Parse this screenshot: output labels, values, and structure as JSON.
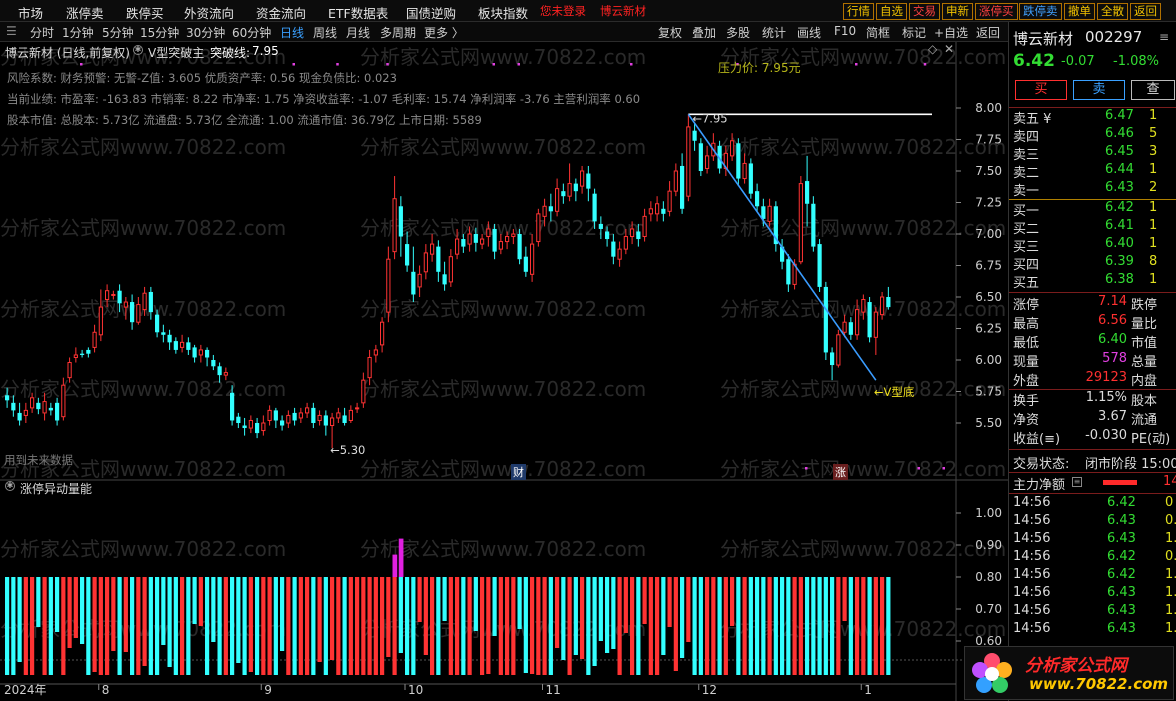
{
  "menu": {
    "items": [
      "市场",
      "涨停卖",
      "跌停买",
      "外资流向",
      "资金流向",
      "ETF数据表",
      "国债逆购",
      "板块指数"
    ],
    "login_text": "您未登录",
    "stock_tag": "博云新材",
    "tools": [
      "行情",
      "自选",
      "交易",
      "申新",
      "涨停买",
      "跌停卖",
      "撤单",
      "全散",
      "返回"
    ]
  },
  "periods": {
    "items": [
      "分时",
      "1分钟",
      "5分钟",
      "15分钟",
      "30分钟",
      "60分钟",
      "日线",
      "周线",
      "月线",
      "多周期",
      "更多 〉"
    ],
    "active": "日线",
    "right": [
      "复权",
      "叠加",
      "多股",
      "统计",
      "画线",
      "F10",
      "简框",
      "标记",
      "+自选",
      "返回"
    ]
  },
  "chart": {
    "title": "博云新材 (日线,前复权)",
    "indicator": "V型突破主",
    "break_label": "突破线:",
    "break_value": "7.95",
    "info": [
      "风险系数: 财务预警: 无警-Z值: 3.605 优质资产率: 0.56 现金负债比: 0.023",
      "当前业绩: 市盈率: -163.83 市销率: 8.22 市净率: 1.75 净资收益率: -1.07 毛利率: 15.74 净利润率 -3.76 主营利润率 0.60",
      "股本市值: 总股本: 5.73亿 流通盘: 5.73亿 全流通: 1.00 流通市值: 36.79亿 上市日期: 5589"
    ],
    "top_note": "压力价: 7.95元",
    "future_note": "用到未来数据",
    "hi_label": "7.95",
    "lo_label": "5.30",
    "v_label": "V型底",
    "mark_cai": "财",
    "mark_zhang": "涨",
    "yticks": [
      "8.00",
      "7.75",
      "7.50",
      "7.25",
      "7.00",
      "6.75",
      "6.50",
      "6.25",
      "6.00",
      "5.75",
      "5.50"
    ]
  },
  "sub": {
    "title": "涨停异动量能",
    "yticks": [
      "1.00",
      "0.90",
      "0.80",
      "0.70",
      "0.60"
    ]
  },
  "xaxis": {
    "labels": [
      "2024年",
      "8",
      "9",
      "10",
      "11",
      "12",
      "1"
    ]
  },
  "watermark": "分析家公式网www.70822.com",
  "logo": {
    "line1": "分析家公式网",
    "line2": "www.70822.com"
  },
  "quote": {
    "name": "博云新材",
    "code": "002297",
    "price": "6.42",
    "change": "-0.07",
    "pct": "-1.08%",
    "buy": "买",
    "sell": "卖",
    "query": "查",
    "asks": [
      {
        "label": "卖五 ¥",
        "price": "6.47",
        "vol": "1"
      },
      {
        "label": "卖四",
        "price": "6.46",
        "vol": "5"
      },
      {
        "label": "卖三",
        "price": "6.45",
        "vol": "3"
      },
      {
        "label": "卖二",
        "price": "6.44",
        "vol": "1"
      },
      {
        "label": "卖一",
        "price": "6.43",
        "vol": "2"
      }
    ],
    "bids": [
      {
        "label": "买一",
        "price": "6.42",
        "vol": "1"
      },
      {
        "label": "买二",
        "price": "6.41",
        "vol": "1"
      },
      {
        "label": "买三",
        "price": "6.40",
        "vol": "1"
      },
      {
        "label": "买四",
        "price": "6.39",
        "vol": "8"
      },
      {
        "label": "买五",
        "price": "6.38",
        "vol": "1"
      }
    ],
    "stats": [
      {
        "l1": "涨停",
        "v1": "7.14",
        "c1": "#ff3030",
        "l2": "跌停"
      },
      {
        "l1": "最高",
        "v1": "6.56",
        "c1": "#ff3030",
        "l2": "量比"
      },
      {
        "l1": "最低",
        "v1": "6.40",
        "c1": "#33dd33",
        "l2": "市值"
      },
      {
        "l1": "现量",
        "v1": "578",
        "c1": "#e040e0",
        "l2": "总量"
      },
      {
        "l1": "外盘",
        "v1": "29123",
        "c1": "#ff3030",
        "l2": "内盘"
      },
      {
        "l1": "换手",
        "v1": "1.15%",
        "c1": "#dcdcdc",
        "l2": "股本"
      },
      {
        "l1": "净资",
        "v1": "3.67",
        "c1": "#dcdcdc",
        "l2": "流通"
      },
      {
        "l1": "收益(≡)",
        "v1": "-0.030",
        "c1": "#dcdcdc",
        "l2": "PE(动)"
      }
    ],
    "status_label": "交易状态:",
    "status_value": "闭市阶段 15:00",
    "flow_label": "主力净额",
    "flow_value": "14",
    "ticks": [
      {
        "t": "14:56",
        "p": "6.42",
        "v": "0"
      },
      {
        "t": "14:56",
        "p": "6.43",
        "v": "0."
      },
      {
        "t": "14:56",
        "p": "6.43",
        "v": "1."
      },
      {
        "t": "14:56",
        "p": "6.42",
        "v": "0."
      },
      {
        "t": "14:56",
        "p": "6.42",
        "v": "1."
      },
      {
        "t": "14:56",
        "p": "6.43",
        "v": "1."
      },
      {
        "t": "14:56",
        "p": "6.43",
        "v": "1."
      },
      {
        "t": "14:56",
        "p": "6.43",
        "v": "1."
      }
    ]
  },
  "chart_data": {
    "type": "candlestick",
    "ylim": [
      5.3,
      8.1
    ],
    "annotations": {
      "high": 7.95,
      "low": 5.3,
      "v_bottom_low": 5.84,
      "breakout_line": 7.95
    },
    "candles": [
      [
        5.72,
        5.68,
        5.78,
        5.62
      ],
      [
        5.66,
        5.6,
        5.72,
        5.55
      ],
      [
        5.58,
        5.52,
        5.66,
        5.48
      ],
      [
        5.56,
        5.6,
        5.66,
        5.5
      ],
      [
        5.62,
        5.7,
        5.74,
        5.58
      ],
      [
        5.66,
        5.61,
        5.7,
        5.57
      ],
      [
        5.58,
        5.67,
        5.74,
        5.52
      ],
      [
        5.62,
        5.6,
        5.66,
        5.56
      ],
      [
        5.66,
        5.52,
        5.7,
        5.48
      ],
      [
        5.55,
        5.8,
        5.86,
        5.52
      ],
      [
        5.86,
        5.98,
        6.02,
        5.82
      ],
      [
        6.02,
        6.04,
        6.1,
        5.98
      ],
      [
        6.05,
        6.04,
        6.08,
        6.02
      ],
      [
        6.08,
        6.05,
        6.1,
        6.02
      ],
      [
        6.1,
        6.22,
        6.28,
        6.06
      ],
      [
        6.2,
        6.42,
        6.56,
        6.15
      ],
      [
        6.48,
        6.55,
        6.6,
        6.42
      ],
      [
        6.52,
        6.52,
        6.55,
        6.48
      ],
      [
        6.55,
        6.45,
        6.6,
        6.38
      ],
      [
        6.42,
        6.46,
        6.5,
        6.32
      ],
      [
        6.46,
        6.3,
        6.52,
        6.24
      ],
      [
        6.3,
        6.44,
        6.5,
        6.28
      ],
      [
        6.4,
        6.53,
        6.58,
        6.35
      ],
      [
        6.54,
        6.38,
        6.58,
        6.32
      ],
      [
        6.36,
        6.22,
        6.4,
        6.18
      ],
      [
        6.22,
        6.2,
        6.28,
        6.14
      ],
      [
        6.2,
        6.14,
        6.24,
        6.08
      ],
      [
        6.15,
        6.08,
        6.18,
        6.05
      ],
      [
        6.1,
        6.14,
        6.2,
        6.06
      ],
      [
        6.14,
        6.08,
        6.18,
        6.04
      ],
      [
        6.1,
        6.02,
        6.12,
        5.98
      ],
      [
        6.04,
        6.08,
        6.12,
        5.98
      ],
      [
        6.08,
        6.02,
        6.1,
        5.95
      ],
      [
        6.0,
        5.95,
        6.04,
        5.92
      ],
      [
        5.95,
        5.88,
        5.98,
        5.82
      ],
      [
        5.88,
        5.9,
        5.94,
        5.84
      ],
      [
        5.74,
        5.52,
        5.8,
        5.48
      ],
      [
        5.55,
        5.5,
        5.58,
        5.46
      ],
      [
        5.48,
        5.46,
        5.54,
        5.4
      ],
      [
        5.46,
        5.52,
        5.56,
        5.42
      ],
      [
        5.5,
        5.42,
        5.54,
        5.38
      ],
      [
        5.44,
        5.5,
        5.56,
        5.4
      ],
      [
        5.52,
        5.6,
        5.64,
        5.48
      ],
      [
        5.6,
        5.52,
        5.62,
        5.46
      ],
      [
        5.52,
        5.48,
        5.56,
        5.44
      ],
      [
        5.5,
        5.56,
        5.6,
        5.46
      ],
      [
        5.58,
        5.52,
        5.62,
        5.48
      ],
      [
        5.54,
        5.58,
        5.62,
        5.5
      ],
      [
        5.58,
        5.62,
        5.66,
        5.54
      ],
      [
        5.62,
        5.5,
        5.66,
        5.46
      ],
      [
        5.52,
        5.56,
        5.6,
        5.48
      ],
      [
        5.56,
        5.48,
        5.6,
        5.4
      ],
      [
        5.48,
        5.54,
        5.58,
        5.3
      ],
      [
        5.54,
        5.58,
        5.62,
        5.5
      ],
      [
        5.56,
        5.5,
        5.62,
        5.48
      ],
      [
        5.52,
        5.6,
        5.64,
        5.5
      ],
      [
        5.62,
        5.62,
        5.66,
        5.58
      ],
      [
        5.66,
        5.84,
        5.9,
        5.62
      ],
      [
        5.86,
        6.02,
        6.08,
        5.8
      ],
      [
        6.04,
        6.08,
        6.12,
        5.98
      ],
      [
        6.12,
        6.3,
        6.34,
        6.06
      ],
      [
        6.38,
        6.8,
        6.9,
        6.3
      ],
      [
        6.86,
        7.28,
        7.46,
        6.8
      ],
      [
        7.22,
        6.98,
        7.3,
        6.82
      ],
      [
        6.92,
        6.75,
        7.02,
        6.7
      ],
      [
        6.7,
        6.52,
        6.9,
        6.46
      ],
      [
        6.58,
        6.68,
        6.75,
        6.5
      ],
      [
        6.7,
        6.85,
        6.92,
        6.64
      ],
      [
        6.84,
        6.92,
        7.0,
        6.78
      ],
      [
        6.9,
        6.7,
        6.95,
        6.62
      ],
      [
        6.68,
        6.6,
        6.78,
        6.55
      ],
      [
        6.62,
        6.82,
        6.88,
        6.58
      ],
      [
        6.84,
        6.96,
        7.04,
        6.8
      ],
      [
        6.96,
        6.9,
        7.0,
        6.85
      ],
      [
        6.92,
        7.0,
        7.06,
        6.86
      ],
      [
        7.0,
        6.93,
        7.05,
        6.86
      ],
      [
        6.92,
        6.96,
        7.0,
        6.88
      ],
      [
        6.98,
        7.04,
        7.1,
        6.9
      ],
      [
        7.04,
        6.86,
        7.08,
        6.8
      ],
      [
        6.88,
        6.94,
        7.0,
        6.84
      ],
      [
        6.94,
        6.98,
        7.02,
        6.88
      ],
      [
        6.98,
        7.0,
        7.04,
        6.92
      ],
      [
        7.0,
        6.8,
        7.04,
        6.76
      ],
      [
        6.82,
        6.7,
        6.9,
        6.66
      ],
      [
        6.68,
        6.92,
        7.0,
        6.62
      ],
      [
        6.94,
        7.16,
        7.2,
        6.9
      ],
      [
        7.14,
        7.22,
        7.28,
        7.06
      ],
      [
        7.22,
        7.18,
        7.32,
        7.1
      ],
      [
        7.18,
        7.36,
        7.44,
        7.14
      ],
      [
        7.34,
        7.3,
        7.4,
        7.24
      ],
      [
        7.3,
        7.4,
        7.56,
        7.26
      ],
      [
        7.4,
        7.34,
        7.44,
        7.26
      ],
      [
        7.38,
        7.5,
        7.54,
        7.32
      ],
      [
        7.48,
        7.36,
        7.54,
        7.26
      ],
      [
        7.32,
        7.1,
        7.36,
        7.04
      ],
      [
        7.08,
        7.04,
        7.14,
        6.96
      ],
      [
        7.02,
        6.96,
        7.06,
        6.9
      ],
      [
        6.94,
        6.82,
        7.0,
        6.76
      ],
      [
        6.8,
        6.88,
        6.94,
        6.74
      ],
      [
        6.88,
        6.98,
        7.04,
        6.84
      ],
      [
        6.98,
        7.04,
        7.1,
        6.92
      ],
      [
        7.02,
        6.96,
        7.08,
        6.9
      ],
      [
        6.98,
        7.14,
        7.2,
        6.94
      ],
      [
        7.16,
        7.2,
        7.26,
        7.1
      ],
      [
        7.16,
        7.24,
        7.3,
        7.1
      ],
      [
        7.2,
        7.16,
        7.26,
        7.1
      ],
      [
        7.18,
        7.34,
        7.42,
        7.14
      ],
      [
        7.34,
        7.5,
        7.56,
        7.3
      ],
      [
        7.54,
        7.2,
        7.64,
        7.16
      ],
      [
        7.3,
        7.85,
        7.95,
        7.26
      ],
      [
        7.82,
        7.74,
        7.88,
        7.66
      ],
      [
        7.72,
        7.5,
        7.76,
        7.46
      ],
      [
        7.52,
        7.62,
        7.7,
        7.48
      ],
      [
        7.62,
        7.72,
        7.8,
        7.58
      ],
      [
        7.7,
        7.52,
        7.74,
        7.48
      ],
      [
        7.52,
        7.64,
        7.7,
        7.46
      ],
      [
        7.62,
        7.74,
        7.8,
        7.58
      ],
      [
        7.72,
        7.44,
        7.76,
        7.38
      ],
      [
        7.44,
        7.56,
        7.64,
        7.4
      ],
      [
        7.56,
        7.32,
        7.6,
        7.28
      ],
      [
        7.34,
        7.22,
        7.4,
        7.18
      ],
      [
        7.22,
        7.12,
        7.28,
        7.06
      ],
      [
        7.1,
        7.22,
        7.28,
        7.06
      ],
      [
        7.22,
        6.92,
        7.26,
        6.86
      ],
      [
        6.9,
        6.78,
        6.96,
        6.72
      ],
      [
        6.8,
        6.6,
        6.84,
        6.54
      ],
      [
        6.6,
        6.76,
        6.8,
        6.56
      ],
      [
        6.78,
        7.4,
        7.46,
        6.76
      ],
      [
        7.42,
        7.24,
        7.62,
        7.06
      ],
      [
        7.24,
        6.9,
        7.3,
        6.86
      ],
      [
        6.92,
        6.58,
        6.96,
        6.54
      ],
      [
        6.58,
        6.06,
        6.62,
        6.0
      ],
      [
        6.06,
        5.96,
        6.1,
        5.84
      ],
      [
        5.96,
        6.2,
        6.24,
        5.94
      ],
      [
        6.22,
        6.3,
        6.36,
        6.18
      ],
      [
        6.3,
        6.2,
        6.34,
        6.16
      ],
      [
        6.2,
        6.4,
        6.48,
        6.16
      ],
      [
        6.38,
        6.48,
        6.52,
        6.32
      ],
      [
        6.46,
        6.18,
        6.5,
        6.14
      ],
      [
        6.18,
        6.38,
        6.42,
        6.04
      ],
      [
        6.36,
        6.5,
        6.54,
        6.32
      ],
      [
        6.5,
        6.42,
        6.58,
        6.4
      ]
    ],
    "sub_indicator": {
      "name": "涨停异动量能",
      "spike_values": [
        0.87,
        0.92
      ],
      "baseline": 0.8
    }
  }
}
